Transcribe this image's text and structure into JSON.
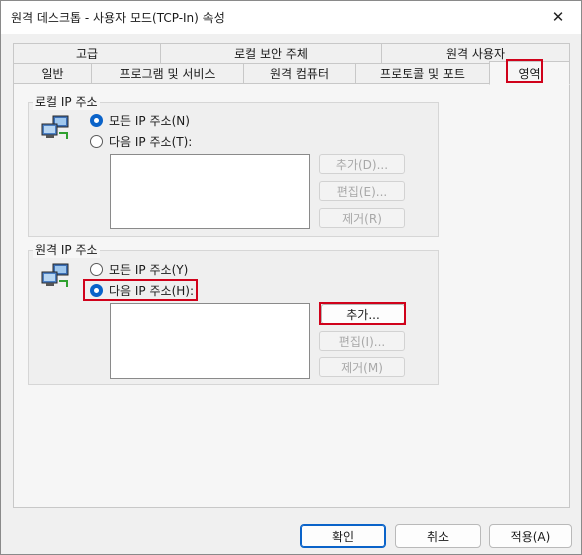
{
  "window": {
    "title": "원격 데스크톱 - 사용자 모드(TCP-In) 속성",
    "close_glyph": "✕"
  },
  "tabs": {
    "row1": [
      "고급",
      "로컬 보안 주체",
      "원격 사용자"
    ],
    "row2": [
      "일반",
      "프로그램 및 서비스",
      "원격 컴퓨터",
      "프로토콜 및 포트",
      "영역"
    ],
    "active": "영역"
  },
  "local_ip": {
    "group_title": "로컬 IP 주소",
    "radio_any": "모든 IP 주소(N)",
    "radio_these": "다음 IP 주소(T):",
    "selected": "any",
    "add": "추가(D)...",
    "edit": "편집(E)...",
    "remove": "제거(R)"
  },
  "remote_ip": {
    "group_title": "원격 IP 주소",
    "radio_any": "모든 IP 주소(Y)",
    "radio_these": "다음 IP 주소(H):",
    "selected": "these",
    "add": "추가...",
    "edit": "편집(I)...",
    "remove": "제거(M)"
  },
  "footer": {
    "ok": "확인",
    "cancel": "취소",
    "apply": "적용(A)"
  },
  "colors": {
    "accent": "#0a63c9",
    "highlight": "#d0021b"
  }
}
